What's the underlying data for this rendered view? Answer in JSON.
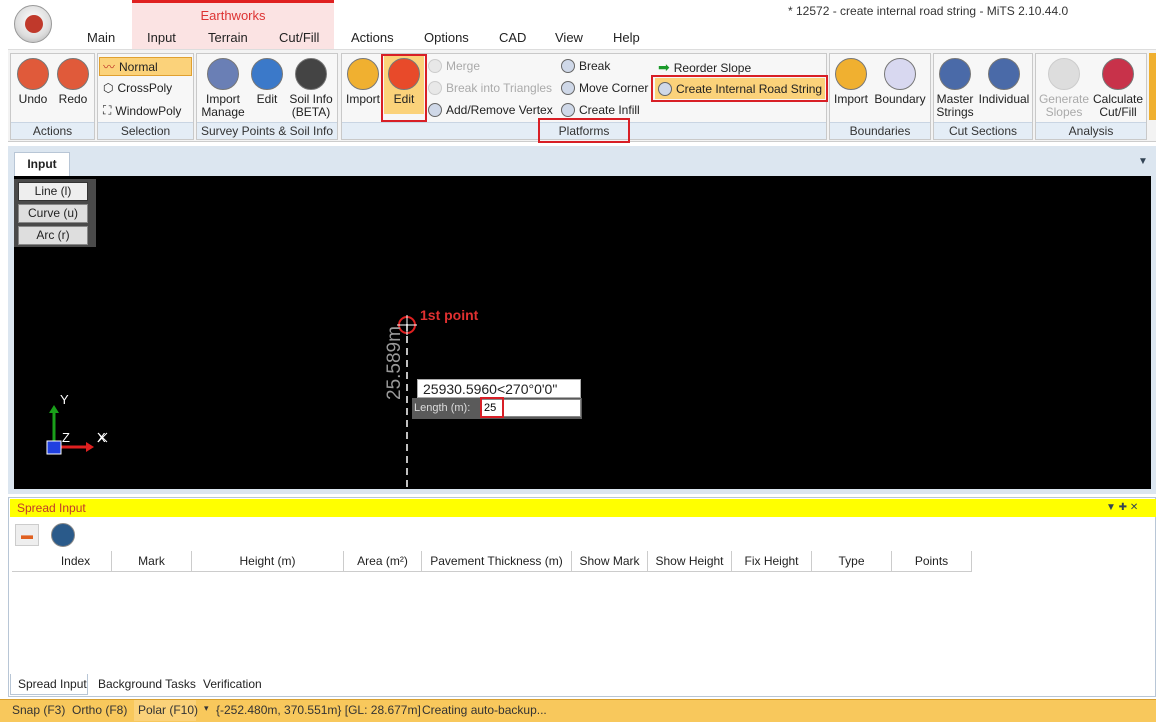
{
  "window": {
    "title": "* 12572 - create internal road string - MiTS 2.10.44.0",
    "context_tab_group": "Earthworks"
  },
  "tabs": [
    "Main",
    "Input",
    "Terrain",
    "Cut/Fill",
    "Actions",
    "Options",
    "CAD",
    "View",
    "Help"
  ],
  "ribbon": {
    "actions": {
      "label": "Actions",
      "undo": "Undo",
      "redo": "Redo"
    },
    "selection": {
      "label": "Selection",
      "normal": "Normal",
      "crosspoly": "CrossPoly",
      "windowpoly": "WindowPoly"
    },
    "survey": {
      "label": "Survey Points & Soil Info",
      "import_manage_1": "Import",
      "import_manage_2": "Manage",
      "edit": "Edit",
      "soil_1": "Soil Info",
      "soil_2": "(BETA)"
    },
    "platforms": {
      "label": "Platforms",
      "import": "Import",
      "edit": "Edit",
      "merge": "Merge",
      "break_triangles": "Break into Triangles",
      "add_remove_vertex": "Add/Remove Vertex",
      "break": "Break",
      "move_corner": "Move Corner",
      "create_infill": "Create Infill",
      "reorder_slope": "Reorder Slope",
      "create_internal_road": "Create Internal Road String"
    },
    "boundaries": {
      "label": "Boundaries",
      "import": "Import",
      "boundary": "Boundary"
    },
    "cut_sections": {
      "label": "Cut Sections",
      "master_1": "Master",
      "master_2": "Strings",
      "individual": "Individual"
    },
    "analysis": {
      "label": "Analysis",
      "generate_1": "Generate",
      "generate_2": "Slopes",
      "calc_1": "Calculate",
      "calc_2": "Cut/Fill"
    }
  },
  "document_tab": "Input",
  "draw_modes": [
    "Line (l)",
    "Curve (u)",
    "Arc (r)"
  ],
  "viewport": {
    "annotation": "1st point",
    "dimension": "25.589m",
    "coord_readout": "25930.5960<270°0'0\"",
    "length_label": "Length (m):",
    "length_value": "25",
    "axis_y": "Y",
    "axis_z": "Z",
    "axis_x": "X"
  },
  "spread": {
    "title": "Spread Input",
    "columns": [
      "Index",
      "Mark",
      "Height (m)",
      "Area (m²)",
      "Pavement Thickness (m)",
      "Show Mark",
      "Show Height",
      "Fix Height",
      "Type",
      "Points"
    ]
  },
  "bottom_tabs": [
    "Spread Input",
    "Background Tasks",
    "Verification"
  ],
  "status": {
    "snap": "Snap (F3)",
    "ortho": "Ortho (F8)",
    "polar": "Polar (F10)",
    "coords": "{-252.480m, 370.551m} [GL: 28.677m]",
    "message": "Creating auto-backup..."
  }
}
